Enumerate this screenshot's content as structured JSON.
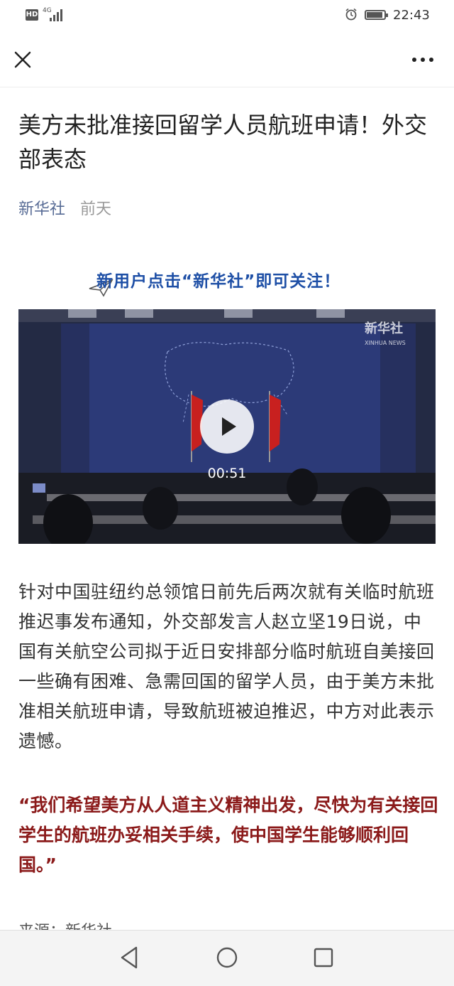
{
  "status": {
    "hd": "HD",
    "network": "4G",
    "time": "22:43",
    "battery_level": 0.9
  },
  "icons": {
    "close": "close-icon",
    "more": "more-icon",
    "back": "back-icon",
    "home": "home-icon",
    "recents": "recents-icon",
    "play": "play-icon"
  },
  "article": {
    "title": "美方未批准接回留学人员航班申请！外交部表态",
    "author": "新华社",
    "date": "前天",
    "banner": "新用户点击“新华社”即可关注！",
    "video": {
      "watermark": "新华社",
      "watermark_sub": "XINHUA NEWS",
      "duration": "00:51"
    },
    "paragraph": "针对中国驻纽约总领馆日前先后两次就有关临时航班推迟事发布通知，外交部发言人赵立坚19日说，中国有关航空公司拟于近日安排部分临时航班自美接回一些确有困难、急需回国的留学人员，由于美方未批准相关航班申请，导致航班被迫推迟，中方对此表示遗憾。",
    "quote": "“我们希望美方从人道主义精神出发，尽快为有关接回学生的航班办妥相关手续，使中国学生能够顺利回国。”",
    "source": "来源：新华社"
  },
  "colors": {
    "author_link": "#576b95",
    "quote": "#8b1a1a",
    "banner": "#1e4fa6"
  }
}
